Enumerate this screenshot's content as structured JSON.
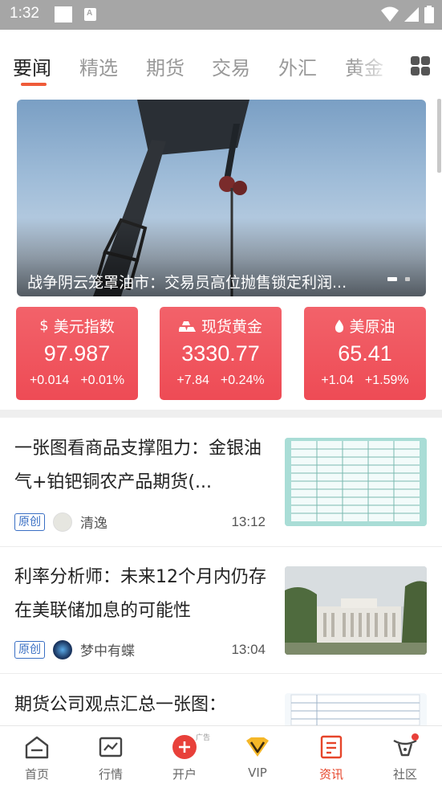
{
  "status_bar": {
    "time": "1:32"
  },
  "tabs": [
    {
      "label": "要闻"
    },
    {
      "label": "精选"
    },
    {
      "label": "期货"
    },
    {
      "label": "交易"
    },
    {
      "label": "外汇"
    },
    {
      "label": "黄金"
    }
  ],
  "banner": {
    "title": "战争阴云笼罩油市：交易员高位抛售锁定利润..."
  },
  "quotes": [
    {
      "name": "美元指数",
      "icon": "dollar-icon",
      "price": "97.987",
      "change": "+0.014",
      "percent": "+0.01%"
    },
    {
      "name": "现货黄金",
      "icon": "gold-bars-icon",
      "price": "3330.77",
      "change": "+7.84",
      "percent": "+0.24%"
    },
    {
      "name": "美原油",
      "icon": "oil-drop-icon",
      "price": "65.41",
      "change": "+1.04",
      "percent": "+1.59%"
    }
  ],
  "news": [
    {
      "title": "一张图看商品支撑阻力：金银油气+铂钯铜农产品期货(...",
      "badge": "原创",
      "author": "清逸",
      "time": "13:12"
    },
    {
      "title": "利率分析师：未来12个月内仍存在美联储加息的可能性",
      "badge": "原创",
      "author": "梦中有蝶",
      "time": "13:04"
    },
    {
      "title": "期货公司观点汇总一张图：",
      "badge": "",
      "author": "",
      "time": ""
    }
  ],
  "bottom_nav": [
    {
      "label": "首页",
      "icon": "home-icon"
    },
    {
      "label": "行情",
      "icon": "chart-icon"
    },
    {
      "label": "开户",
      "icon": "add-circle-icon",
      "ad_tag": "广告"
    },
    {
      "label": "VIP",
      "icon": "vip-icon"
    },
    {
      "label": "资讯",
      "icon": "news-icon"
    },
    {
      "label": "社区",
      "icon": "community-icon"
    }
  ],
  "colors": {
    "accent": "#ef5b39",
    "quote_card": "#ef5059",
    "badge_blue": "#3a6fc4",
    "active_nav": "#e6452a"
  }
}
